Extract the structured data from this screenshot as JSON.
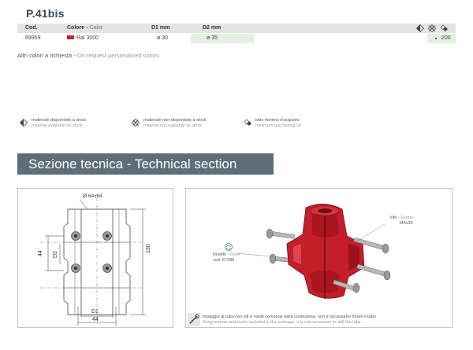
{
  "product": {
    "title": "P.41bis"
  },
  "table": {
    "headers": {
      "cod": "Cod.",
      "colore_it": "Colore - ",
      "colore_en": "Color",
      "d1": "D1 mm",
      "d2": "D2 mm"
    },
    "row": {
      "cod": "69959",
      "colore": "Ral 3000",
      "d1": "ø 30",
      "d2": "ø 35",
      "qty": "200"
    }
  },
  "notes": {
    "colors_it": "Altri colori a richiesta - ",
    "colors_en": "On request personalized colors"
  },
  "legend": {
    "stock_it": "materiale disponibile a stock",
    "stock_en": "material available on stock",
    "nostock_it": "materiale non disponibile a stock",
    "nostock_en": "material not available on stock",
    "minlot_it": "lotto minimo d'acquisto",
    "minlot_en": "minimum purchasing lot"
  },
  "section": {
    "title": "Sezione tecnica - Technical section"
  },
  "drawing": {
    "diam_label": "Ø 64x64",
    "dim_44_left": "44",
    "dim_d2": "D2",
    "dim_130": "130",
    "dim_d1": "D1",
    "dim_44_bottom": "44"
  },
  "photo": {
    "screw_it": "Vite - ",
    "screw_en": "Screw",
    "screw_size": "M6x30",
    "rivet_it": "Rivetto - ",
    "rivet_en": "Rivet",
    "rivet_code": "cod. 67288",
    "caption_it": "fissaggio al tubo con viti e rivetti compresi nella confezione, non è necessario forare il tubo",
    "caption_en": "fixing screws and rivets included in the package, it is not necessary to drill the tube"
  },
  "colors": {
    "accent": "#c8202c",
    "banner": "#5d6e7a",
    "highlight": "#e2f0e0"
  }
}
